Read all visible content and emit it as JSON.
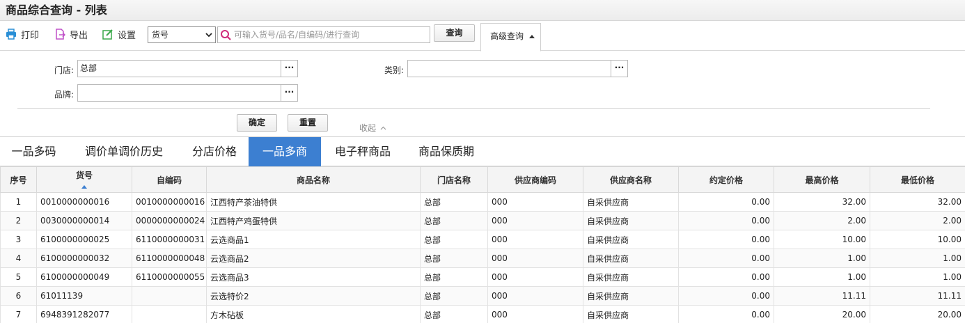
{
  "title": "商品综合查询 - 列表",
  "toolbar": {
    "print_label": "打印",
    "export_label": "导出",
    "settings_label": "设置",
    "field_select": "货号",
    "search_placeholder": "可输入货号/品名/自编码/进行查询",
    "query_label": "查询",
    "advanced_label": "高级查询"
  },
  "advanced": {
    "store_label": "门店:",
    "store_value": "总部",
    "category_label": "类别:",
    "category_value": "",
    "brand_label": "品牌:",
    "brand_value": "",
    "confirm_label": "确定",
    "reset_label": "重置",
    "collapse_label": "收起"
  },
  "tabs": [
    "一品多码",
    "调价单调价历史",
    "分店价格",
    "一品多商",
    "电子秤商品",
    "商品保质期"
  ],
  "active_tab": "一品多商",
  "table": {
    "columns": [
      "序号",
      "货号",
      "自编码",
      "商品名称",
      "门店名称",
      "供应商编码",
      "供应商名称",
      "约定价格",
      "最高价格",
      "最低价格"
    ],
    "rows": [
      [
        "1",
        "0010000000016",
        "0010000000016",
        "江西特产茶油特供",
        "总部",
        "000",
        "自采供应商",
        "0.00",
        "32.00",
        "32.00"
      ],
      [
        "2",
        "0030000000014",
        "0000000000024",
        "江西特产鸡蛋特供",
        "总部",
        "000",
        "自采供应商",
        "0.00",
        "2.00",
        "2.00"
      ],
      [
        "3",
        "6100000000025",
        "6110000000031",
        "云选商品1",
        "总部",
        "000",
        "自采供应商",
        "0.00",
        "10.00",
        "10.00"
      ],
      [
        "4",
        "6100000000032",
        "6110000000048",
        "云选商品2",
        "总部",
        "000",
        "自采供应商",
        "0.00",
        "1.00",
        "1.00"
      ],
      [
        "5",
        "6100000000049",
        "6110000000055",
        "云选商品3",
        "总部",
        "000",
        "自采供应商",
        "0.00",
        "1.00",
        "1.00"
      ],
      [
        "6",
        "61011139",
        "",
        "云选特价2",
        "总部",
        "000",
        "自采供应商",
        "0.00",
        "11.11",
        "11.11"
      ],
      [
        "7",
        "6948391282077",
        "",
        "方木砧板",
        "总部",
        "000",
        "自采供应商",
        "0.00",
        "20.00",
        "20.00"
      ]
    ]
  },
  "colors": {
    "accent": "#3c7fd1",
    "print_icon": "#2a8fd6",
    "export_icon": "#c050c8",
    "settings_icon": "#3aa84a"
  }
}
